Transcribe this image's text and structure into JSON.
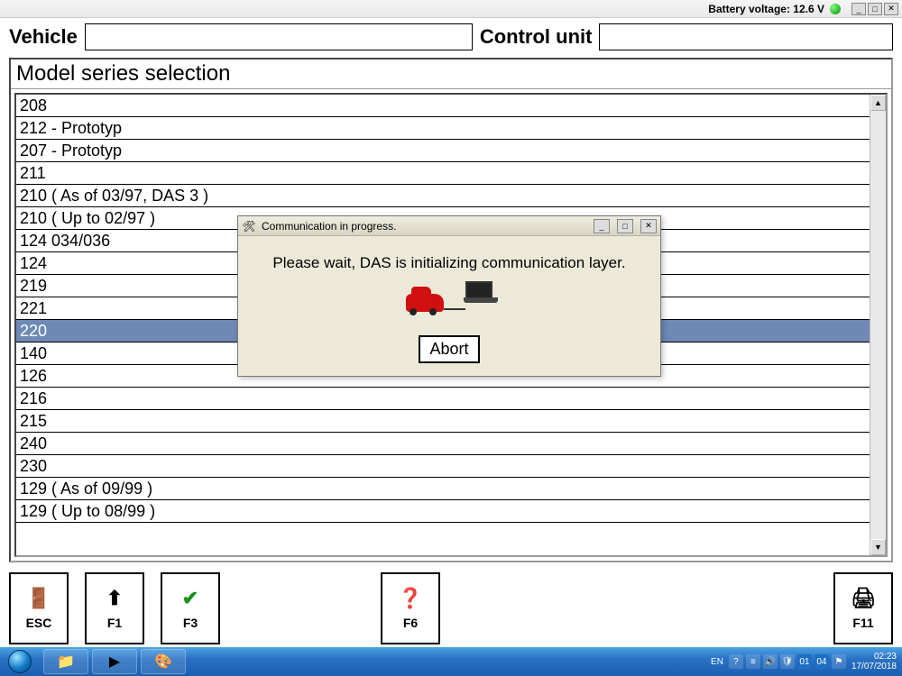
{
  "titlebar": {
    "battery_label": "Battery voltage: 12.6 V"
  },
  "header": {
    "vehicle_label": "Vehicle",
    "vehicle_value": "",
    "control_unit_label": "Control unit",
    "control_unit_value": ""
  },
  "panel": {
    "title": "Model series selection"
  },
  "models": [
    "208",
    "212 - Prototyp",
    "207 - Prototyp",
    "211",
    "210 ( As of 03/97, DAS 3 )",
    "210 ( Up to 02/97 )",
    "124 034/036",
    "124",
    "219",
    "221",
    "220",
    "140",
    "126",
    "216",
    "215",
    "240",
    "230",
    "129 ( As of 09/99 )",
    "129 ( Up to 08/99 )"
  ],
  "selected_index": 10,
  "dialog": {
    "title": "Communication in progress.",
    "message": "Please wait, DAS is initializing communication layer.",
    "abort_label": "Abort"
  },
  "fkeys": {
    "esc": "ESC",
    "f1": "F1",
    "f3": "F3",
    "f6": "F6",
    "f11": "F11"
  },
  "taskbar": {
    "lang": "EN",
    "tray_badges": [
      "01",
      "04"
    ],
    "time": "02:23",
    "date": "17/07/2018"
  }
}
